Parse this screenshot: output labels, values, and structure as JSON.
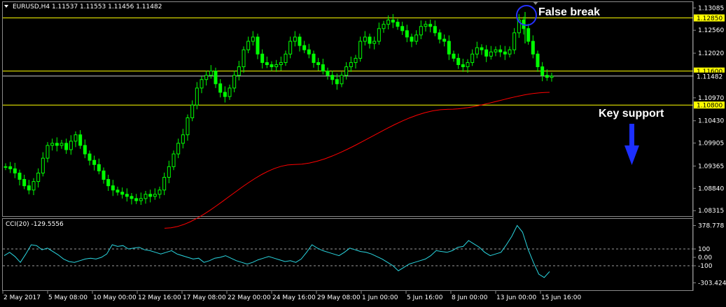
{
  "header": {
    "symbol_line": "EURUSD,H4  1.11537 1.11553 1.11456 1.11482",
    "cci_line": "CCI(20) -129.5556"
  },
  "colors": {
    "background": "#000000",
    "bull_candle": "#00ff00",
    "ma": "#ff0000",
    "level": "#ffff00",
    "cci": "#2ad6e0",
    "price_label_bg": "#ffff00",
    "arrow": "#1c2fff",
    "circle": "#2430ff"
  },
  "price_axis": [
    "1.13085",
    "1.12560",
    "1.12020",
    "1.11482",
    "1.10970",
    "1.10430",
    "1.09905",
    "1.09365",
    "1.08840",
    "1.08315"
  ],
  "price_levels": [
    {
      "value": 1.1285,
      "label": "1.12850"
    },
    {
      "value": 1.116,
      "label": "1.11600"
    },
    {
      "value": 1.108,
      "label": "1.10800"
    }
  ],
  "current_price": {
    "value": 1.11482,
    "label": "1.11482"
  },
  "time_axis": [
    "2 May 2017",
    "5 May 08:00",
    "10 May 00:00",
    "12 May 16:00",
    "17 May 08:00",
    "22 May 00:00",
    "24 May 16:00",
    "29 May 08:00",
    "1 Jun 00:00",
    "5 Jun 16:00",
    "8 Jun 00:00",
    "13 Jun 00:00",
    "15 Jun 16:00"
  ],
  "cci_axis": [
    "378.778",
    "100",
    "0.00",
    "-100",
    "-303.4242"
  ],
  "annotations": {
    "false_break": "False break",
    "key_support": "Key support"
  },
  "icons": {
    "arrow": "down-arrow-icon",
    "circle": "highlight-circle-icon",
    "dropdown": "chart-menu-triangle-icon"
  },
  "chart_data": {
    "type": "candlestick",
    "title": "EURUSD,H4",
    "price_range": [
      1.0822,
      1.1314
    ],
    "cci_range": [
      -350,
      400
    ],
    "close_series": [
      1.0935,
      1.093,
      1.092,
      1.0905,
      1.089,
      1.088,
      1.09,
      1.092,
      1.0955,
      1.0985,
      1.099,
      1.0985,
      1.099,
      1.0975,
      1.0995,
      1.101,
      1.0985,
      1.0965,
      1.095,
      1.094,
      1.0925,
      1.0905,
      1.089,
      1.088,
      1.0875,
      1.087,
      1.0865,
      1.086,
      1.0855,
      1.086,
      1.087,
      1.0865,
      1.087,
      1.088,
      1.091,
      1.0935,
      1.0965,
      1.099,
      1.101,
      1.105,
      1.108,
      1.112,
      1.114,
      1.115,
      1.116,
      1.113,
      1.111,
      1.11,
      1.112,
      1.115,
      1.117,
      1.121,
      1.123,
      1.124,
      1.12,
      1.118,
      1.1175,
      1.117,
      1.1175,
      1.118,
      1.12,
      1.123,
      1.124,
      1.122,
      1.121,
      1.12,
      1.118,
      1.1175,
      1.116,
      1.115,
      1.114,
      1.113,
      1.115,
      1.117,
      1.118,
      1.119,
      1.123,
      1.124,
      1.1225,
      1.123,
      1.126,
      1.127,
      1.128,
      1.1275,
      1.1265,
      1.1255,
      1.124,
      1.123,
      1.1245,
      1.1265,
      1.127,
      1.1265,
      1.125,
      1.1235,
      1.123,
      1.12,
      1.119,
      1.1175,
      1.117,
      1.118,
      1.12,
      1.1215,
      1.121,
      1.1195,
      1.1205,
      1.121,
      1.1205,
      1.12,
      1.121,
      1.125,
      1.128,
      1.126,
      1.123,
      1.12,
      1.117,
      1.115,
      1.1145,
      1.1148
    ],
    "ma_series": [
      1.079,
      1.094,
      1.107,
      1.111
    ],
    "cci_series": [
      20,
      60,
      10,
      -60,
      40,
      150,
      140,
      90,
      110,
      70,
      30,
      -20,
      -50,
      -60,
      -40,
      -20,
      -10,
      -20,
      0,
      40,
      150,
      130,
      140,
      100,
      110,
      120,
      90,
      80,
      60,
      40,
      60,
      80,
      40,
      20,
      0,
      -20,
      -10,
      -60,
      -40,
      -10,
      0,
      20,
      -10,
      -40,
      -60,
      -80,
      -60,
      -30,
      -10,
      10,
      -10,
      -30,
      -50,
      -40,
      -60,
      -20,
      60,
      150,
      110,
      80,
      60,
      40,
      20,
      60,
      110,
      90,
      70,
      60,
      40,
      10,
      -20,
      -60,
      -100,
      -160,
      -120,
      -80,
      -60,
      -40,
      -20,
      20,
      80,
      70,
      60,
      80,
      120,
      130,
      200,
      160,
      120,
      60,
      20,
      40,
      60,
      150,
      250,
      380,
      300,
      100,
      -60,
      -200,
      -240,
      -170
    ],
    "levels": [
      1.1285,
      1.116,
      1.108
    ],
    "series": [
      {
        "name": "EURUSD,H4"
      },
      {
        "name": "CCI(20)"
      }
    ]
  }
}
